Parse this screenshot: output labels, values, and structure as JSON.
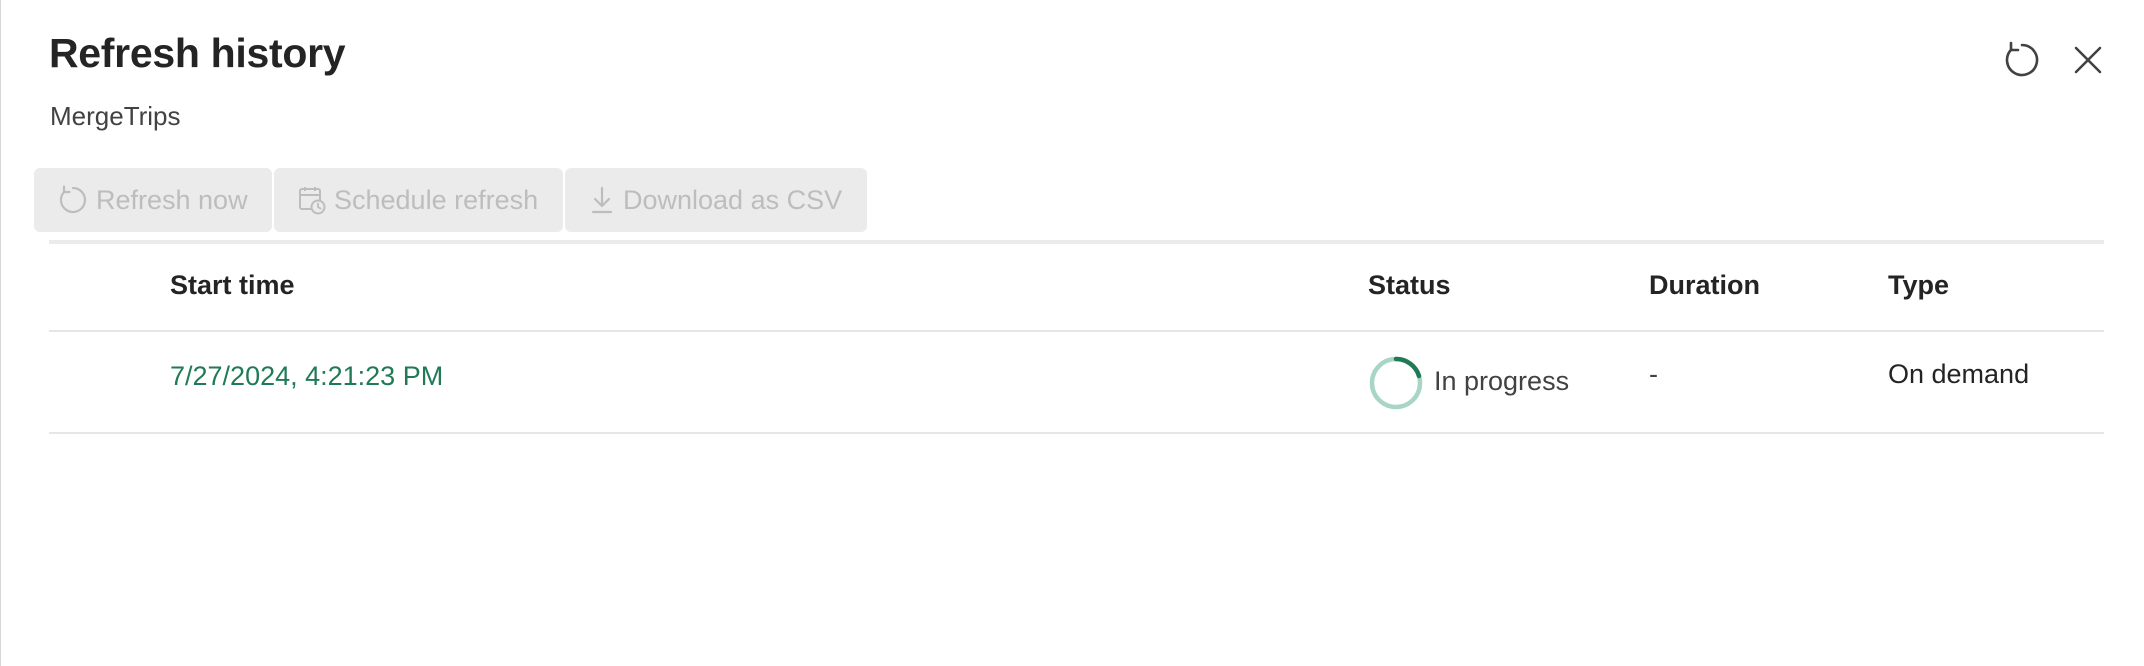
{
  "header": {
    "title": "Refresh history",
    "subtitle": "MergeTrips",
    "refresh_icon": "refresh-icon",
    "close_icon": "close-icon"
  },
  "toolbar": {
    "refresh_now_label": "Refresh now",
    "schedule_refresh_label": "Schedule refresh",
    "download_csv_label": "Download as CSV"
  },
  "table": {
    "columns": [
      "Start time",
      "Status",
      "Duration",
      "Type"
    ],
    "rows": [
      {
        "start_time": "7/27/2024, 4:21:23 PM",
        "status": "In progress",
        "duration": "-",
        "type": "On demand"
      }
    ]
  },
  "colors": {
    "accent": "#1f7a55",
    "spinner_track": "#a8d5c6",
    "disabled_text": "#bdbdbd",
    "disabled_bg": "#ebebeb"
  }
}
